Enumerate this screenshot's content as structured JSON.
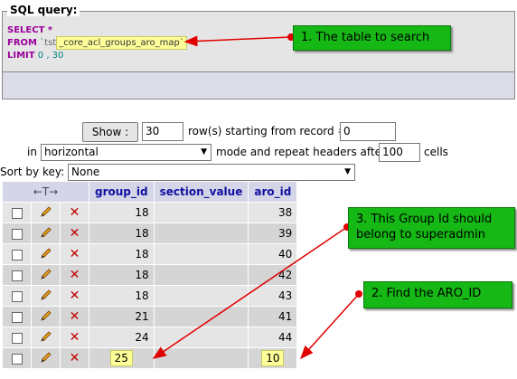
{
  "sql": {
    "legend": "SQL query:",
    "select_kw": "SELECT",
    "select_rest": " *",
    "from_kw": "FROM",
    "table_prefix": " `tst",
    "table_name": "_core_acl_groups_aro_map`",
    "limit_kw": "LIMIT",
    "limit_value": " 0 , 30"
  },
  "nav": {
    "show_button": "Show :",
    "rows_value": "30",
    "rows_text": "row(s) starting from record #",
    "start_value": "0",
    "in_label": "in",
    "mode_value": "horizontal",
    "mode_text": "mode and repeat headers after",
    "headers_value": "100",
    "cells_label": "cells",
    "sort_label": "Sort by key:",
    "sort_value": "None"
  },
  "table": {
    "nav_arrows": "←T→",
    "headers": [
      "group_id",
      "section_value",
      "aro_id"
    ],
    "rows": [
      {
        "group_id": "18",
        "section_value": "",
        "aro_id": "38"
      },
      {
        "group_id": "18",
        "section_value": "",
        "aro_id": "39"
      },
      {
        "group_id": "18",
        "section_value": "",
        "aro_id": "40"
      },
      {
        "group_id": "18",
        "section_value": "",
        "aro_id": "42"
      },
      {
        "group_id": "18",
        "section_value": "",
        "aro_id": "43"
      },
      {
        "group_id": "21",
        "section_value": "",
        "aro_id": "41"
      },
      {
        "group_id": "24",
        "section_value": "",
        "aro_id": "44"
      },
      {
        "group_id": "25",
        "section_value": "",
        "aro_id": "10"
      }
    ]
  },
  "callouts": {
    "table": "1. The table to search",
    "group": "3. This Group Id should belong to superadmin",
    "aro": "2. Find the ARO_ID"
  },
  "icons": {
    "edit": "pencil-icon",
    "delete": "delete-x-icon",
    "checkbox": "row-checkbox"
  },
  "colors": {
    "callout_bg": "#15b815",
    "arrow": "#e00000",
    "highlight": "#ffff99"
  }
}
